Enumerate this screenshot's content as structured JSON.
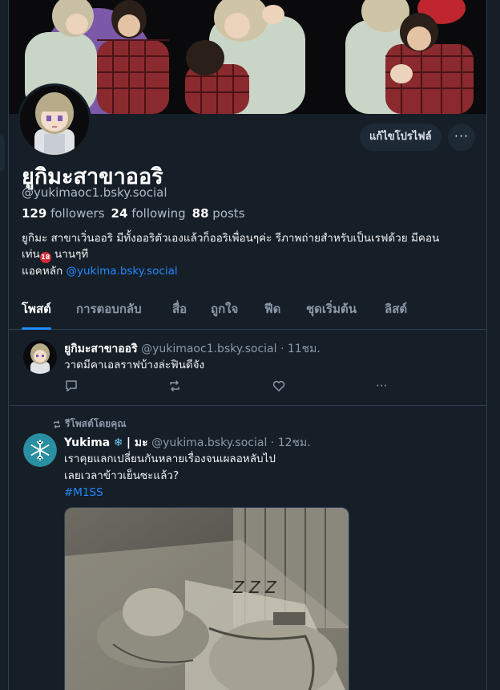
{
  "profile": {
    "display_name": "ยูกิมะสาขาออริ",
    "handle": "@yukimaoc1.bsky.social",
    "followers_count": "129",
    "followers_label": "followers",
    "following_count": "24",
    "following_label": "following",
    "posts_count": "88",
    "posts_label": "posts",
    "bio_line1": "ยูกิมะ สาขาเวิ่นออริ มีทั้งออริตัวเองแล้วก็ออริเพื่อนๆค่ะ  รีภาพถ่ายสำหรับเป็นเรฟด้วย มีคอน",
    "bio_line2a": "เท่น",
    "bio_badge": "18",
    "bio_line2b": "นานๆที",
    "bio_line3_prefix": "แอคหลัก",
    "bio_link": "@yukima.bsky.social",
    "edit_button": "แก้ไขโปรไฟล์",
    "more_button": "···"
  },
  "tabs": [
    "โพสต์",
    "การตอบกลับ",
    "สื่อ",
    "ถูกใจ",
    "ฟีด",
    "ชุดเริ่มต้น",
    "ลิสต์"
  ],
  "active_tab": "โพสต์",
  "posts": [
    {
      "author_name": "ยูกิมะสาขาออริ",
      "author_handle": "@yukimaoc1.bsky.social",
      "time": "· 11ชม.",
      "text": "วาดมีคาเอลราฟบ้างล่ะฟินดีจัง",
      "more": "···"
    },
    {
      "repost_label": "รีโพสต์โดยคุณ",
      "author_name": "Yukima",
      "author_name_suffix": "| มะ",
      "author_handle": "@yukima.bsky.social",
      "time": "· 12ชม.",
      "text_line1": "เราคุยแลกเปลี่ยนกันหลายเรื่องจนเผลอหลับไป",
      "text_line2": "เลยเวลาข้าวเย็นซะแล้ว?",
      "hashtag": "#M1SS",
      "zzz": "Z Z Z"
    }
  ],
  "colors": {
    "background": "#161e27",
    "accent": "#208bfe",
    "muted_text": "#8b98a8",
    "border": "#2e4052"
  }
}
